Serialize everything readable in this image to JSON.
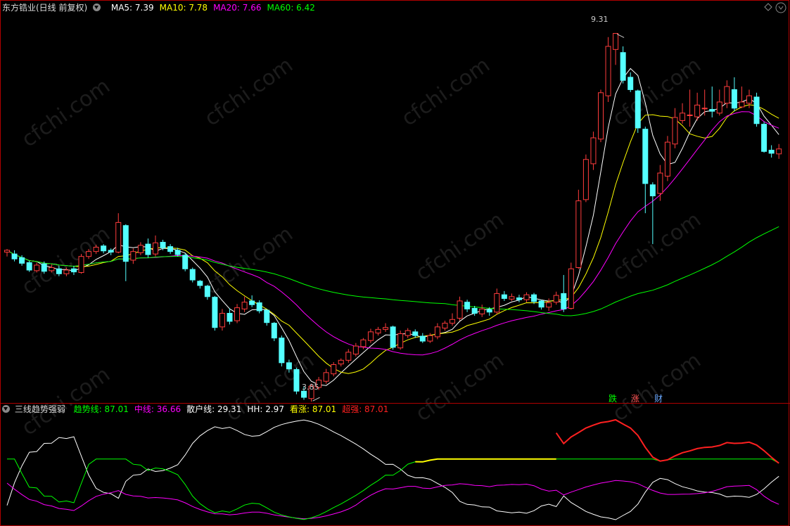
{
  "main_panel": {
    "title": "东方锆业(日线 前复权)",
    "ma_legend": [
      {
        "label": "MA5:",
        "value": "7.39",
        "color": "#ffffff"
      },
      {
        "label": "MA10:",
        "value": "7.78",
        "color": "#ffff00"
      },
      {
        "label": "MA20:",
        "value": "7.66",
        "color": "#ff00ff"
      },
      {
        "label": "MA60:",
        "value": "6.42",
        "color": "#00ff00"
      }
    ],
    "high_marker": "9.31",
    "low_marker": "3.85",
    "buttons": {
      "drop": "跌",
      "rise": "涨",
      "finance": "财"
    },
    "watermark": "cfchi.com"
  },
  "indicator_panel": {
    "title": "三线趋势强弱",
    "legend": [
      {
        "label": "趋势线:",
        "value": "87.01",
        "color": "#00ff00"
      },
      {
        "label": "中线:",
        "value": "36.66",
        "color": "#ff00ff"
      },
      {
        "label": "散户线:",
        "value": "29.31",
        "color": "#ffffff"
      },
      {
        "label": "HH:",
        "value": "2.97",
        "color": "#ffffff"
      },
      {
        "label": "看涨:",
        "value": "87.01",
        "color": "#ffff00"
      },
      {
        "label": "超强:",
        "value": "87.01",
        "color": "#ff2020"
      }
    ]
  },
  "colors": {
    "up": "#ff3c3c",
    "down": "#54ffff",
    "ma5": "#ffffff",
    "ma10": "#ffff00",
    "ma20": "#ff00ff",
    "ma60": "#00ff00"
  },
  "chart_data": {
    "type": "candlestick",
    "ylim": [
      3.5,
      9.6
    ],
    "candles": [
      [
        5.77,
        5.8,
        5.82,
        5.7
      ],
      [
        5.74,
        5.66,
        5.8,
        5.62
      ],
      [
        5.68,
        5.59,
        5.72,
        5.55
      ],
      [
        5.6,
        5.48,
        5.63,
        5.45
      ],
      [
        5.47,
        5.56,
        5.6,
        5.44
      ],
      [
        5.58,
        5.46,
        5.62,
        5.42
      ],
      [
        5.47,
        5.52,
        5.57,
        5.44
      ],
      [
        5.5,
        5.42,
        5.55,
        5.38
      ],
      [
        5.42,
        5.48,
        5.52,
        5.38
      ],
      [
        5.5,
        5.45,
        5.55,
        5.4
      ],
      [
        5.44,
        5.7,
        5.74,
        5.42
      ],
      [
        5.7,
        5.78,
        5.82,
        5.66
      ],
      [
        5.78,
        5.85,
        5.89,
        5.74
      ],
      [
        5.87,
        5.79,
        5.9,
        5.75
      ],
      [
        5.8,
        5.77,
        5.83,
        5.72
      ],
      [
        5.77,
        6.25,
        6.4,
        5.75
      ],
      [
        6.2,
        5.62,
        6.22,
        5.3
      ],
      [
        5.64,
        5.78,
        5.83,
        5.58
      ],
      [
        5.76,
        5.88,
        5.93,
        5.72
      ],
      [
        5.9,
        5.73,
        5.99,
        5.68
      ],
      [
        5.74,
        5.92,
        6.04,
        5.7
      ],
      [
        5.93,
        5.84,
        5.97,
        5.8
      ],
      [
        5.86,
        5.78,
        5.9,
        5.74
      ],
      [
        5.8,
        5.73,
        5.84,
        5.7
      ],
      [
        5.72,
        5.5,
        5.75,
        5.46
      ],
      [
        5.49,
        5.32,
        5.52,
        5.28
      ],
      [
        5.3,
        5.23,
        5.32,
        5.18
      ],
      [
        5.22,
        5.05,
        5.24,
        5.0
      ],
      [
        5.04,
        4.55,
        5.06,
        4.5
      ],
      [
        4.56,
        4.78,
        4.85,
        4.5
      ],
      [
        4.78,
        4.65,
        4.86,
        4.6
      ],
      [
        4.66,
        4.87,
        4.93,
        4.62
      ],
      [
        4.85,
        4.96,
        5.05,
        4.8
      ],
      [
        4.98,
        4.92,
        5.07,
        4.88
      ],
      [
        4.95,
        4.82,
        4.99,
        4.78
      ],
      [
        4.83,
        4.63,
        4.85,
        4.58
      ],
      [
        4.62,
        4.38,
        4.64,
        4.33
      ],
      [
        4.38,
        3.98,
        4.42,
        3.92
      ],
      [
        3.98,
        3.88,
        4.03,
        3.82
      ],
      [
        3.87,
        3.52,
        3.9,
        3.47
      ],
      [
        3.52,
        3.42,
        3.59,
        3.38
      ],
      [
        3.4,
        3.6,
        3.64,
        3.35
      ],
      [
        3.58,
        3.7,
        3.75,
        3.54
      ],
      [
        3.68,
        3.82,
        3.88,
        3.64
      ],
      [
        3.8,
        3.95,
        3.99,
        3.76
      ],
      [
        3.96,
        4.02,
        4.05,
        3.92
      ],
      [
        4.02,
        4.15,
        4.2,
        3.98
      ],
      [
        4.12,
        4.25,
        4.3,
        4.08
      ],
      [
        4.24,
        4.35,
        4.38,
        4.2
      ],
      [
        4.34,
        4.48,
        4.53,
        4.3
      ],
      [
        4.46,
        4.52,
        4.56,
        4.42
      ],
      [
        4.52,
        4.55,
        4.62,
        4.48
      ],
      [
        4.56,
        4.23,
        4.58,
        4.19
      ],
      [
        4.22,
        4.45,
        4.5,
        4.19
      ],
      [
        4.42,
        4.5,
        4.54,
        4.38
      ],
      [
        4.48,
        4.42,
        4.52,
        4.38
      ],
      [
        4.41,
        4.33,
        4.46,
        4.3
      ],
      [
        4.33,
        4.42,
        4.46,
        4.3
      ],
      [
        4.4,
        4.56,
        4.62,
        4.36
      ],
      [
        4.54,
        4.62,
        4.66,
        4.5
      ],
      [
        4.62,
        4.68,
        4.78,
        4.58
      ],
      [
        4.7,
        4.98,
        5.05,
        4.66
      ],
      [
        4.96,
        4.85,
        5.0,
        4.8
      ],
      [
        4.86,
        4.78,
        4.9,
        4.74
      ],
      [
        4.77,
        4.85,
        4.92,
        4.72
      ],
      [
        4.84,
        4.8,
        4.88,
        4.74
      ],
      [
        4.8,
        5.1,
        5.18,
        4.76
      ],
      [
        5.08,
        5.02,
        5.14,
        4.98
      ],
      [
        5.01,
        5.05,
        5.1,
        4.98
      ],
      [
        5.03,
        5.0,
        5.08,
        4.96
      ],
      [
        5.0,
        5.08,
        5.12,
        4.96
      ],
      [
        5.08,
        4.97,
        5.11,
        4.93
      ],
      [
        4.98,
        4.88,
        5.0,
        4.84
      ],
      [
        4.88,
        4.95,
        5.02,
        4.82
      ],
      [
        4.96,
        5.07,
        5.13,
        4.92
      ],
      [
        5.1,
        4.85,
        5.4,
        4.8
      ],
      [
        4.86,
        5.5,
        5.6,
        4.84
      ],
      [
        5.52,
        6.6,
        6.78,
        5.5
      ],
      [
        6.62,
        7.27,
        7.35,
        6.58
      ],
      [
        7.2,
        7.62,
        7.72,
        7.1
      ],
      [
        7.6,
        8.35,
        8.4,
        7.55
      ],
      [
        8.3,
        9.1,
        9.25,
        8.2
      ],
      [
        9.05,
        9.31,
        9.31,
        8.8
      ],
      [
        9.0,
        8.55,
        9.1,
        8.5
      ],
      [
        8.6,
        8.4,
        8.68,
        8.36
      ],
      [
        8.38,
        7.78,
        8.4,
        7.7
      ],
      [
        7.76,
        6.88,
        7.8,
        6.4
      ],
      [
        6.86,
        6.68,
        6.9,
        5.9
      ],
      [
        6.72,
        7.05,
        7.18,
        6.6
      ],
      [
        7.0,
        7.55,
        7.65,
        6.92
      ],
      [
        7.52,
        7.95,
        8.1,
        7.45
      ],
      [
        7.9,
        8.02,
        8.18,
        7.85
      ],
      [
        7.98,
        7.99,
        8.4,
        7.8
      ],
      [
        7.96,
        8.15,
        8.35,
        7.9
      ],
      [
        8.1,
        8.1,
        8.4,
        7.98
      ],
      [
        8.08,
        8.05,
        8.45,
        7.95
      ],
      [
        8.02,
        8.2,
        8.4,
        7.98
      ],
      [
        8.18,
        8.45,
        8.55,
        8.1
      ],
      [
        8.4,
        8.1,
        8.6,
        8.05
      ],
      [
        8.12,
        8.2,
        8.45,
        8.1
      ],
      [
        8.18,
        8.3,
        8.4,
        8.1
      ],
      [
        8.28,
        7.85,
        8.35,
        7.8
      ],
      [
        7.84,
        7.4,
        7.88,
        7.38
      ],
      [
        7.42,
        7.37,
        7.5,
        7.3
      ],
      [
        7.36,
        7.44,
        7.52,
        7.28
      ]
    ]
  }
}
